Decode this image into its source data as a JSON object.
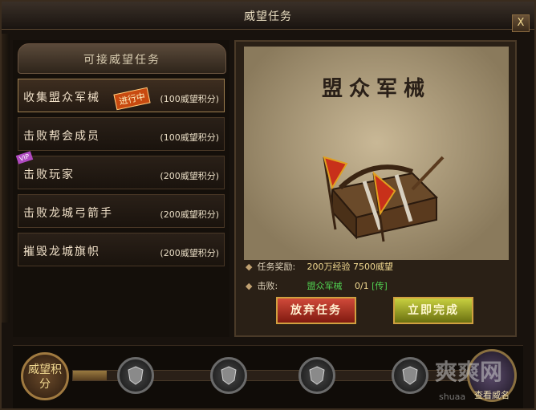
{
  "window": {
    "title": "威望任务",
    "close_label": "X"
  },
  "task_list": {
    "header": "可接威望任务",
    "items": [
      {
        "name": "收集盟众军械",
        "points": "(100威望积分)",
        "badge": "进行中",
        "active": true
      },
      {
        "name": "击败帮会成员",
        "points": "(100威望积分)"
      },
      {
        "name": "击败玩家",
        "points": "(200威望积分)",
        "tag": "VIP"
      },
      {
        "name": "击败龙城弓箭手",
        "points": "(200威望积分)"
      },
      {
        "name": "摧毁龙城旗帜",
        "points": "(200威望积分)"
      }
    ]
  },
  "detail": {
    "title": "盟众军械",
    "reward_label": "任务奖励:",
    "reward_value": "200万经验 7500威望",
    "defeat_label": "击败:",
    "defeat_target": "盟众军械",
    "defeat_progress": "0/1",
    "defeat_link": "[传]",
    "abandon_button": "放弃任务",
    "complete_button": "立即完成"
  },
  "progress": {
    "points_button": "威望积分",
    "fill_fraction": 0.08,
    "rank_label": "查看威名"
  },
  "watermark": {
    "text": "爽爽网",
    "url": "shuaa"
  }
}
